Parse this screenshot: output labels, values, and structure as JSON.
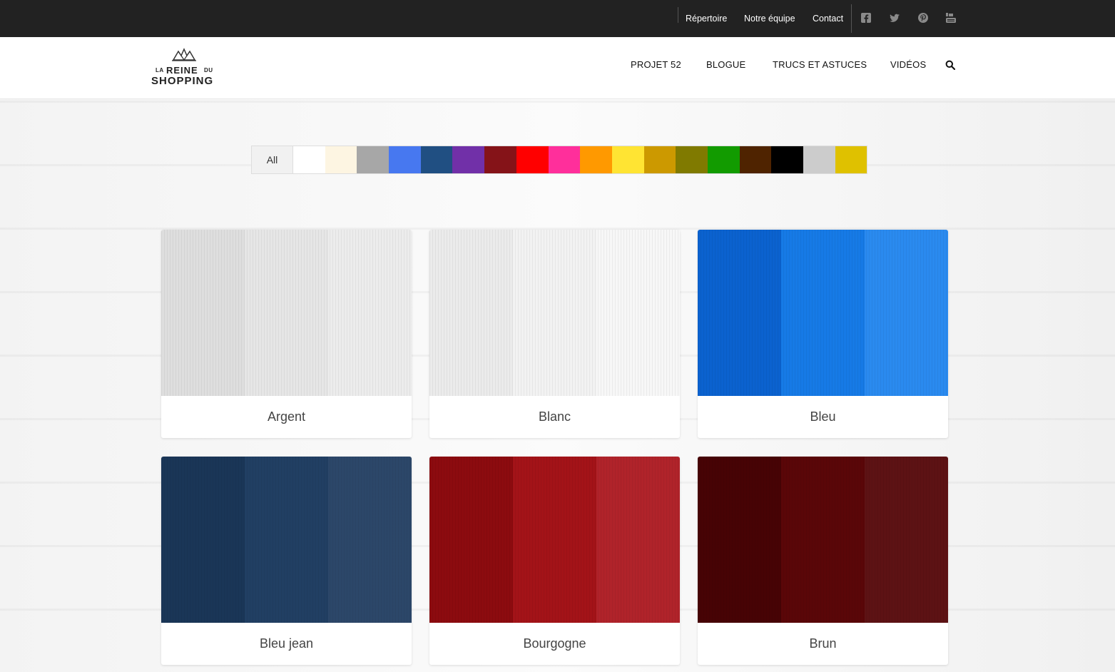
{
  "topbar": {
    "links": [
      "Répertoire",
      "Notre équipe",
      "Contact"
    ],
    "social_icons": [
      "facebook-icon",
      "twitter-icon",
      "pinterest-icon",
      "youtube-icon"
    ]
  },
  "logo": {
    "la": "LA",
    "reine": "REINE",
    "du": "DU",
    "shopping": "SHOPPING"
  },
  "nav": {
    "items": [
      "PROJET 52",
      "BLOGUE",
      "TRUCS ET ASTUCES",
      "VIDÉOS"
    ],
    "search_icon": "search-icon"
  },
  "filters": {
    "all_label": "All",
    "swatches": [
      "#ffffff",
      "#fdf5e2",
      "#a7a7a7",
      "#4778f0",
      "#204f82",
      "#7130a8",
      "#851318",
      "#ff0000",
      "#ff2f9b",
      "#ff9900",
      "#ffe433",
      "#cc9900",
      "#807a00",
      "#129b00",
      "#4f2300",
      "#000000",
      "#cccccc",
      "#dfc100"
    ]
  },
  "cards": [
    {
      "label": "Argent",
      "colors": [
        "#dedede",
        "#e6e6e6",
        "#ececec"
      ]
    },
    {
      "label": "Blanc",
      "colors": [
        "#ebebeb",
        "#f2f2f2",
        "#f7f7f7"
      ]
    },
    {
      "label": "Bleu",
      "colors": [
        "#0b62cf",
        "#167ae6",
        "#2a8aef"
      ]
    },
    {
      "label": "Bleu jean",
      "colors": [
        "#1a3657",
        "#213f63",
        "#2c4769"
      ]
    },
    {
      "label": "Bourgogne",
      "colors": [
        "#8c0b0f",
        "#a31318",
        "#b0232a"
      ]
    },
    {
      "label": "Brun",
      "colors": [
        "#470305",
        "#5a0608",
        "#5d1214"
      ]
    }
  ]
}
